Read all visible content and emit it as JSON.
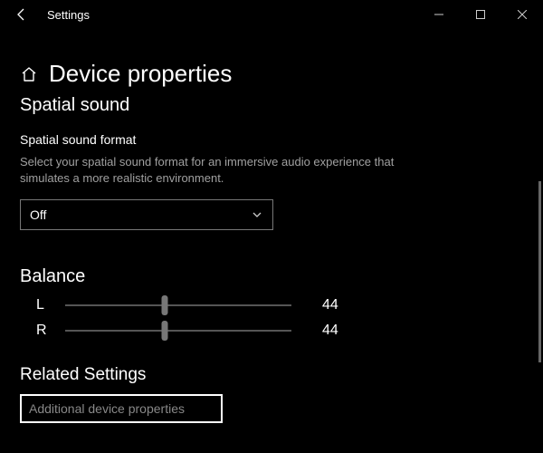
{
  "titlebar": {
    "title": "Settings"
  },
  "page": {
    "heading": "Device properties",
    "spatial_section": "Spatial sound",
    "spatial_label": "Spatial sound format",
    "spatial_desc": "Select your spatial sound format for an immersive audio experience that simulates a more realistic environment.",
    "spatial_selected": "Off",
    "balance_section": "Balance",
    "balance": {
      "left_label": "L",
      "left_value": "44",
      "left_pct": 44,
      "right_label": "R",
      "right_value": "44",
      "right_pct": 44
    },
    "related_section": "Related Settings",
    "related_link": "Additional device properties"
  }
}
